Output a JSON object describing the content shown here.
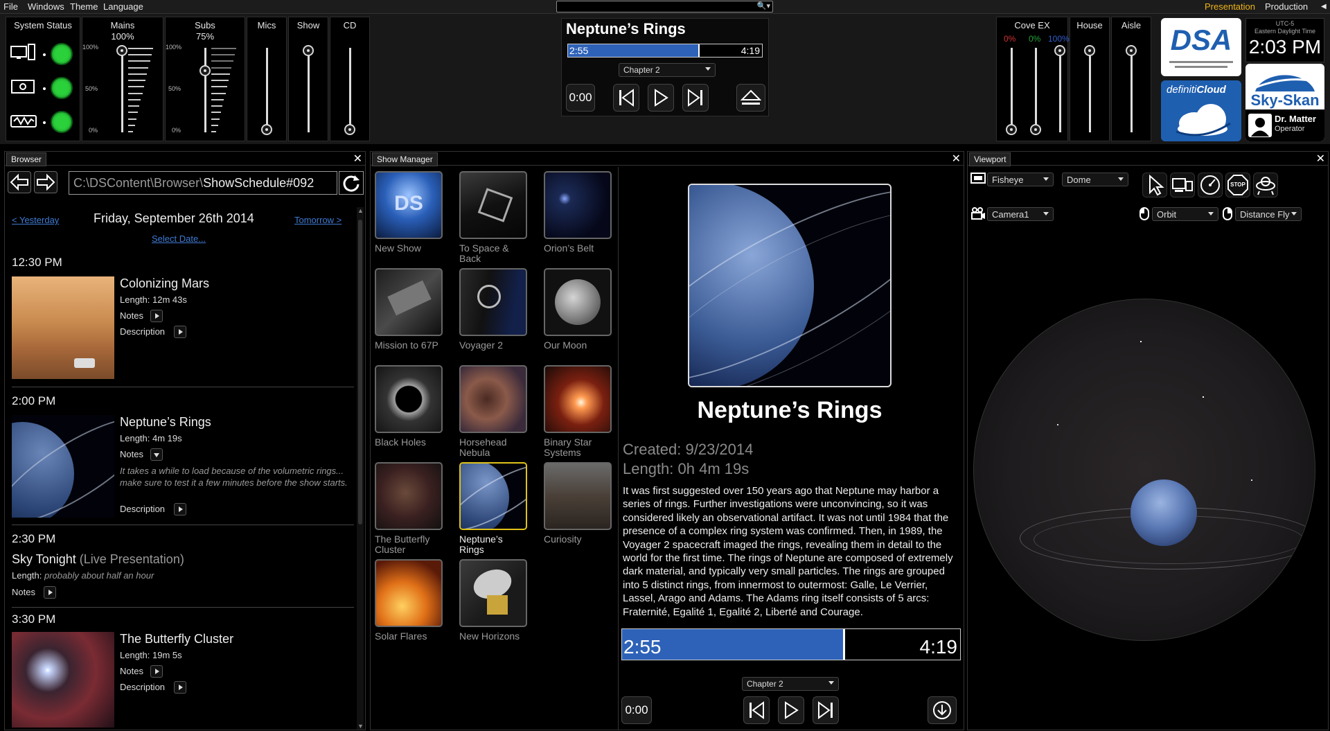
{
  "menu": {
    "file": "File",
    "windows": "Windows",
    "theme": "Theme",
    "language": "Language",
    "presentation": "Presentation",
    "production": "Production"
  },
  "colors": {
    "accent_presentation": "#f0b418",
    "status_green": "#2bd13b",
    "progress_blue": "#2e62b8",
    "link_blue": "#3f7bd4",
    "selection_yellow": "#e0c21a",
    "dsa_blue": "#1f5fb0"
  },
  "system_status": {
    "title": "System Status",
    "rows": [
      {
        "icon": "computer-tower-icon",
        "ok": true
      },
      {
        "icon": "projector-icon",
        "ok": true
      },
      {
        "icon": "network-wave-icon",
        "ok": true
      }
    ]
  },
  "mains": {
    "title": "Mains",
    "value": "100%",
    "scale": [
      "100%",
      "50%",
      "0%"
    ],
    "level": 1.0
  },
  "subs": {
    "title": "Subs",
    "value": "75%",
    "scale": [
      "100%",
      "50%",
      "0%"
    ],
    "level": 0.75
  },
  "mics": {
    "title": "Mics",
    "level": 0.0
  },
  "show": {
    "title": "Show",
    "level": 1.0
  },
  "cd": {
    "title": "CD",
    "level": 0.0
  },
  "player": {
    "title": "Neptune’s Rings",
    "elapsed": "2:55",
    "total": "4:19",
    "progress": 0.68,
    "chapter": "Chapter 2",
    "reset": "0:00"
  },
  "cove": {
    "title": "Cove EX",
    "r": "0%",
    "g": "0%",
    "b": "100%",
    "r_level": 0.0,
    "g_level": 0.0,
    "b_level": 1.0
  },
  "house": {
    "title": "House",
    "level": 1.0
  },
  "aisle": {
    "title": "Aisle",
    "level": 1.0
  },
  "logos": {
    "dsa": "DSA",
    "definiti_a": "definiti",
    "definiti_b": "Cloud",
    "skyskan": "Sky-Skan"
  },
  "clock": {
    "tz": "UTC-5",
    "tz_name": "Eastern Daylight Time",
    "time": "2:03 PM"
  },
  "user": {
    "name": "Dr. Matter",
    "role": "Operator"
  },
  "browser": {
    "tab": "Browser",
    "path_prefix": "C:\\DSContent\\Browser\\",
    "path_main": "ShowSchedule#092",
    "yesterday": "< Yesterday",
    "tomorrow": "Tomorrow >",
    "date": "Friday, September 26th 2014",
    "select_date": "Select Date...",
    "entries": [
      {
        "time": "12:30 PM",
        "title": "Colonizing Mars",
        "length": "Length: 12m 43s",
        "notes": "Notes",
        "description": "Description"
      },
      {
        "time": "2:00 PM",
        "title": "Neptune’s Rings",
        "length": "Length: 4m 19s",
        "notes": "Notes",
        "note_text": "It takes a while to load because of the volumetric rings... make sure to test it a few minutes before the show starts.",
        "description": "Description"
      },
      {
        "time": "2:30 PM",
        "title": "Sky Tonight",
        "title_extra": "(Live Presentation)",
        "length_label": "Length:",
        "length_value": "probably about half an hour",
        "notes": "Notes"
      },
      {
        "time": "3:30 PM",
        "title": "The Butterfly Cluster",
        "length": "Length: 19m 5s",
        "notes": "Notes",
        "description": "Description"
      }
    ]
  },
  "show_manager": {
    "tab": "Show Manager",
    "shows": [
      {
        "label": "New Show",
        "label2": ""
      },
      {
        "label": "To Space &",
        "label2": "Back"
      },
      {
        "label": "Orion’s Belt",
        "label2": ""
      },
      {
        "label": "Mission to 67P",
        "label2": ""
      },
      {
        "label": "Voyager 2",
        "label2": ""
      },
      {
        "label": "Our Moon",
        "label2": ""
      },
      {
        "label": "Black Holes",
        "label2": ""
      },
      {
        "label": "Horsehead",
        "label2": "Nebula"
      },
      {
        "label": "Binary Star",
        "label2": "Systems"
      },
      {
        "label": "The Butterfly",
        "label2": "Cluster"
      },
      {
        "label": "Neptune’s",
        "label2": "Rings"
      },
      {
        "label": "Curiosity",
        "label2": ""
      },
      {
        "label": "Solar Flares",
        "label2": ""
      },
      {
        "label": "New Horizons",
        "label2": ""
      }
    ],
    "detail": {
      "title": "Neptune’s Rings",
      "created": "Created: 9/23/2014",
      "length": "Length: 0h 4m 19s",
      "description": "It was first suggested over 150 years ago that Neptune may harbor a series of rings. Further investigations were unconvincing, so it was considered likely an observational artifact. It was not until 1984 that the presence of a complex ring system was confirmed. Then, in 1989, the Voyager 2 spacecraft imaged the rings, revealing them in detail to the world for the first time. The rings of Neptune are composed of extremely dark material, and typically very small particles. The rings are grouped into 5 distinct rings, from innermost to outermost: Galle, Le Verrier, Lassel, Arago and Adams. The Adams ring itself consists of 5 arcs: Fraternité, Egalité 1, Egalité 2, Liberté and Courage.",
      "elapsed": "2:55",
      "total": "4:19",
      "progress": 0.66,
      "chapter": "Chapter 2",
      "reset": "0:00"
    }
  },
  "viewport": {
    "tab": "Viewport",
    "projection": "Fisheye",
    "surface": "Dome",
    "camera": "Camera1",
    "mode_left": "Orbit",
    "mode_right": "Distance Fly",
    "stop": "STOP"
  }
}
